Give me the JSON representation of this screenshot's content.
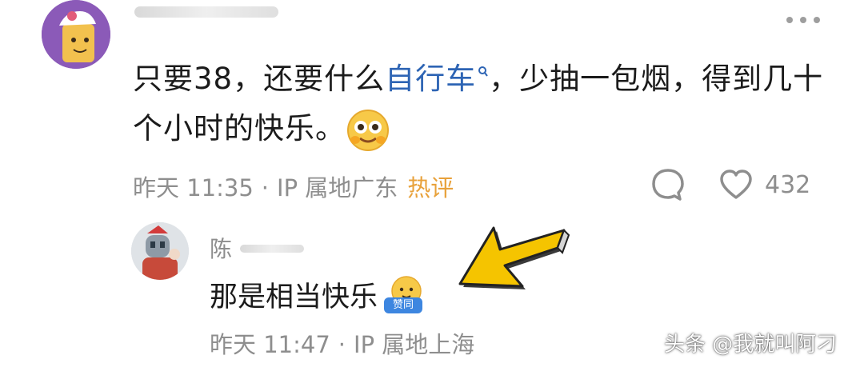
{
  "main_comment": {
    "text_part1": "只要38，还要什么",
    "link_text": "自行车",
    "text_part2": "，少抽一包烟，得到几十个小时的快乐。",
    "time": "昨天 11:35",
    "separator": "·",
    "ip_location": "IP 属地广东",
    "hot_tag": "热评",
    "like_count": "432"
  },
  "reply": {
    "name": "陈",
    "text": "那是相当快乐",
    "emoji_label": "赞同",
    "time": "昨天 11:47",
    "separator": "·",
    "ip_location": "IP 属地上海"
  },
  "watermark": "头条 @我就叫阿刁",
  "colors": {
    "link": "#2d64b4",
    "hot_tag": "#e8a13a",
    "meta": "#8e8e8e",
    "arrow_fill": "#f5c400"
  }
}
